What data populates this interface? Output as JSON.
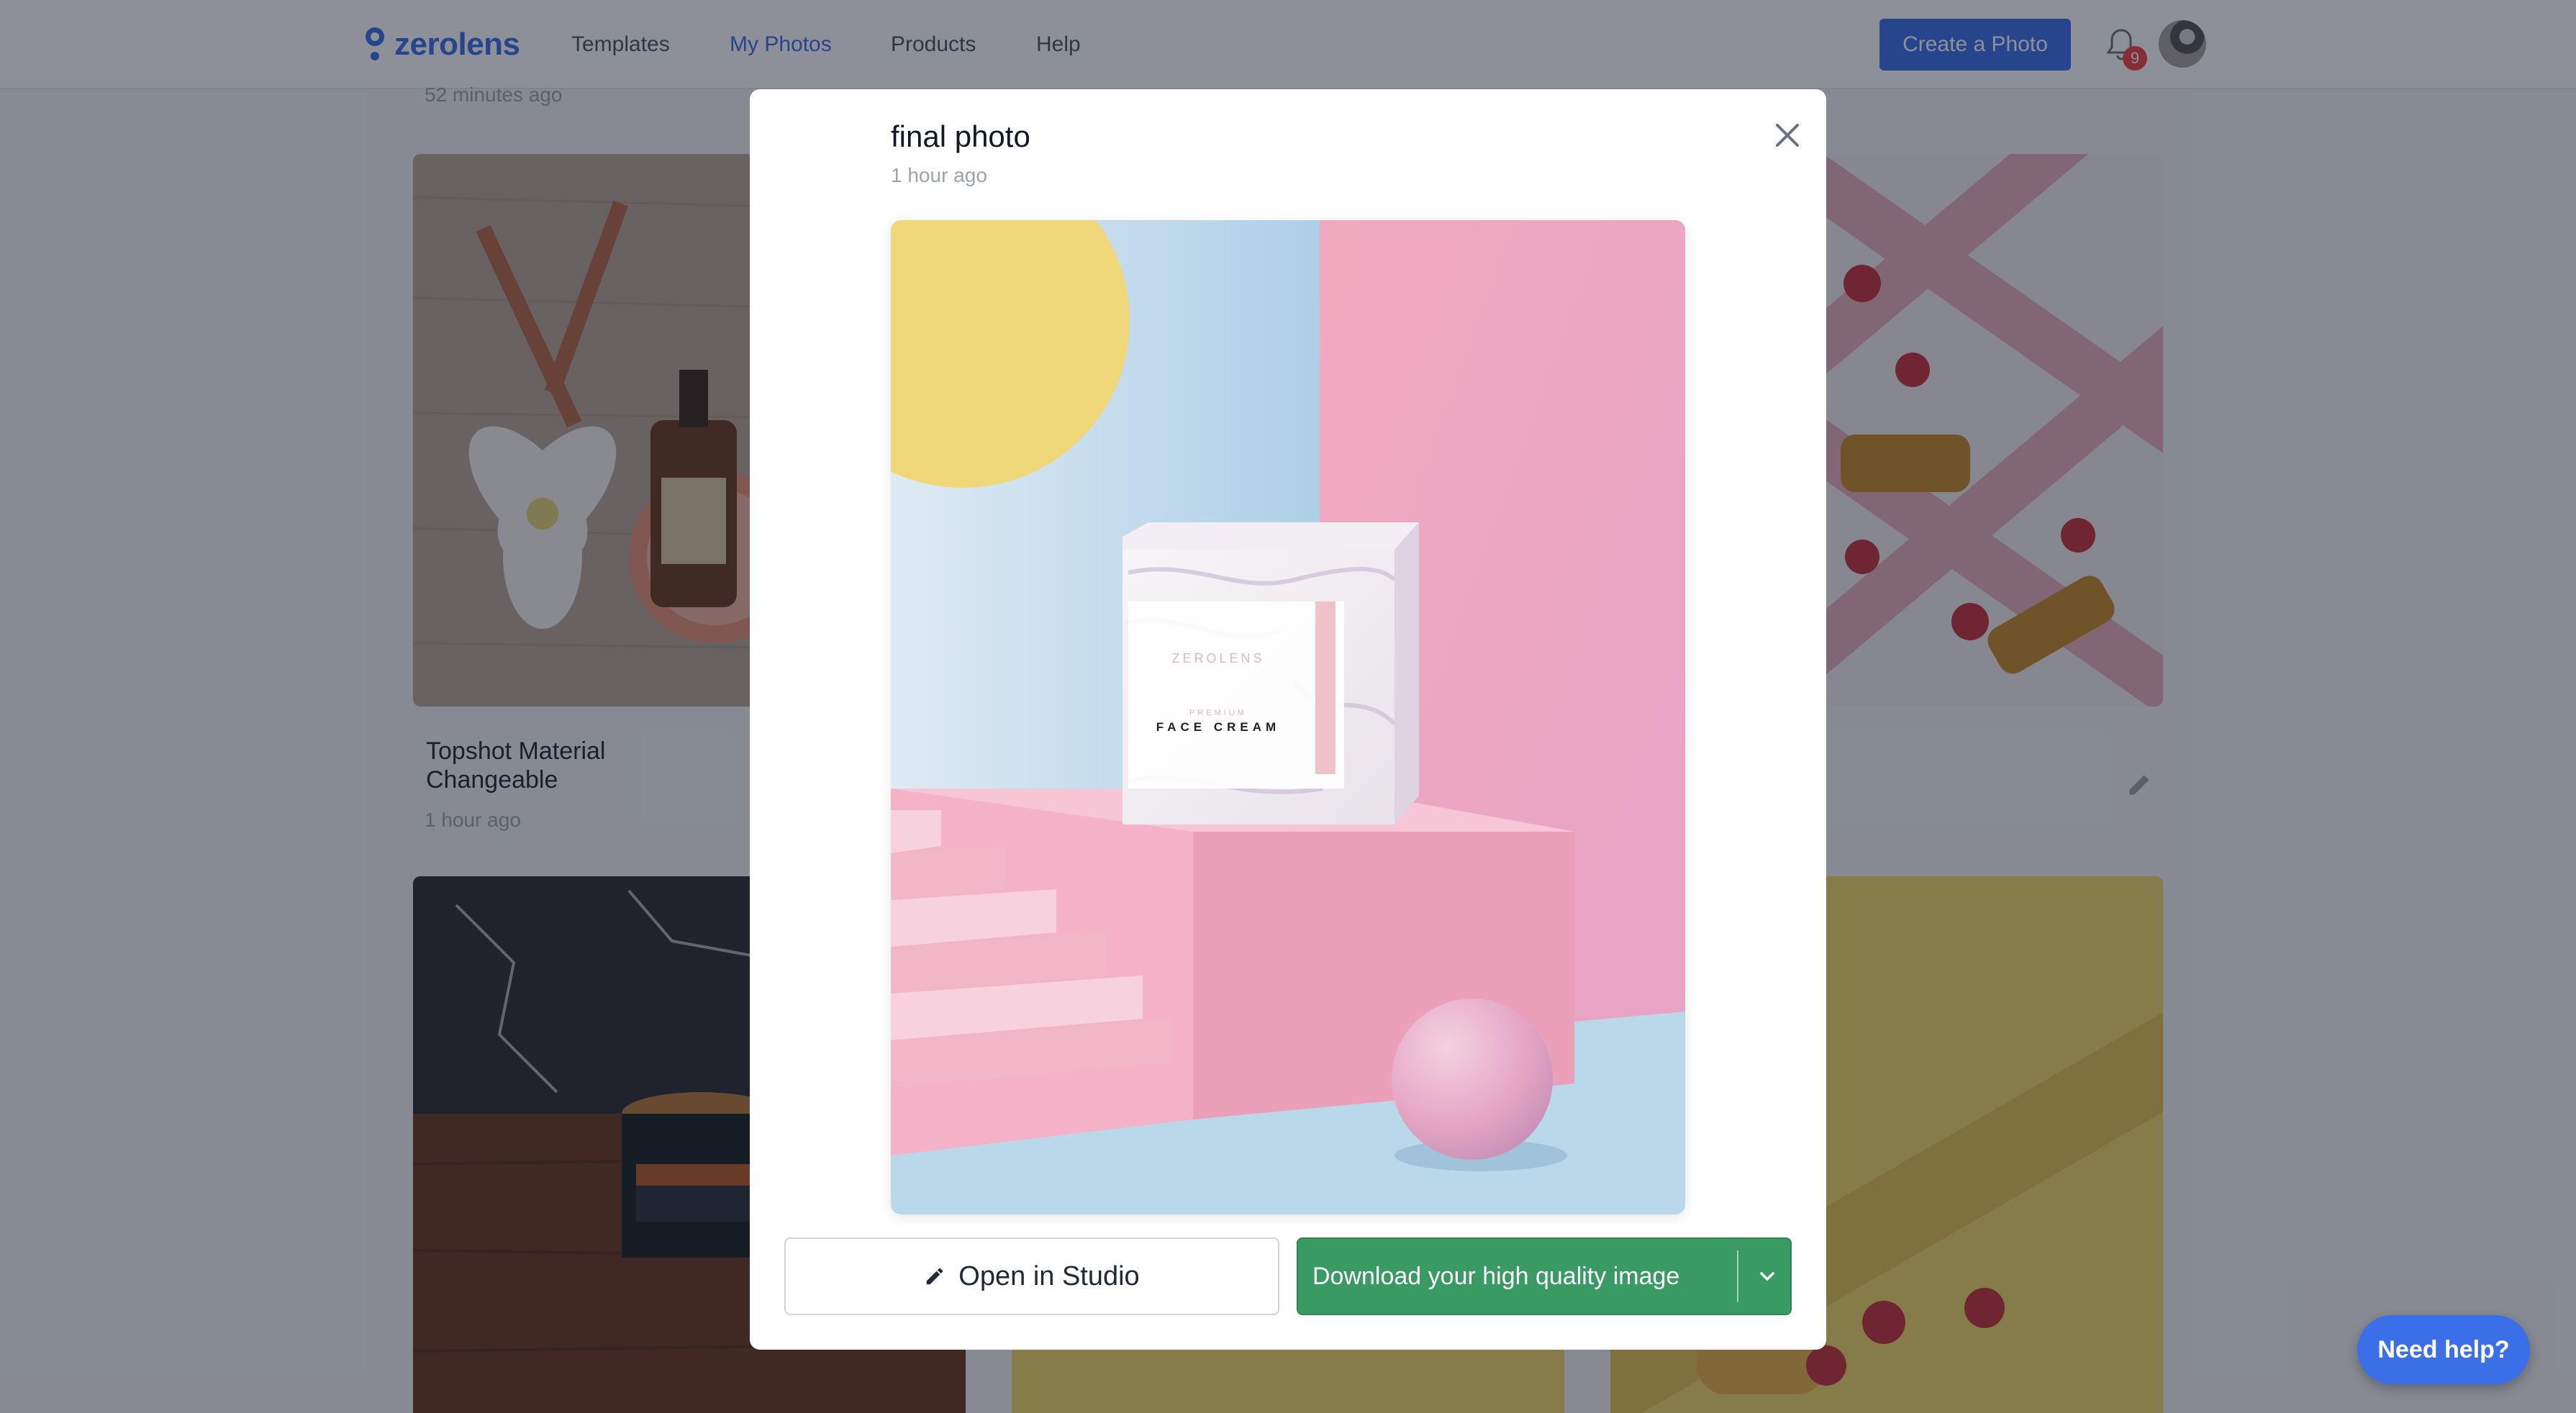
{
  "nav": {
    "logo_text": "zerolens",
    "links": [
      "Templates",
      "My Photos",
      "Products",
      "Help"
    ],
    "active_link": "My Photos",
    "create_button": "Create a Photo",
    "notification_count": "9"
  },
  "gallery": {
    "prev_row_time": "52 minutes ago",
    "cards": [
      {
        "title_line1": "Topshot Material",
        "title_line2": "Changeable",
        "time": "1 hour ago"
      }
    ]
  },
  "modal": {
    "title": "final photo",
    "time": "1 hour ago",
    "product_brand": "ZEROLENS",
    "product_kicker": "PREMIUM",
    "product_name": "FACE CREAM",
    "open_studio_label": "Open in Studio",
    "download_label": "Download your high quality image"
  },
  "help_button": "Need help?",
  "colors": {
    "brand_blue": "#3b6fe8",
    "download_green": "#3a9a63",
    "badge_red": "#ef4444"
  },
  "icons": [
    "logo-pin-icon",
    "bell-icon",
    "close-icon",
    "pencil-icon",
    "chevron-down-icon"
  ]
}
